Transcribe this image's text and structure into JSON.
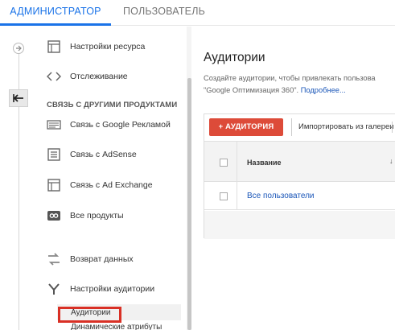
{
  "tabs": {
    "admin": "АДМИНИСТРАТОР",
    "user": "ПОЛЬЗОВАТЕЛЬ"
  },
  "nav": {
    "items": [
      {
        "label": "Настройки ресурса",
        "icon": "property-settings-icon"
      },
      {
        "label": "Отслеживание",
        "icon": "code-icon"
      }
    ],
    "section_title": "СВЯЗЬ С ДРУГИМИ ПРОДУКТАМИ",
    "linked": [
      {
        "label": "Связь с Google Рекламой",
        "icon": "google-ads-icon"
      },
      {
        "label": "Связь с AdSense",
        "icon": "adsense-icon"
      },
      {
        "label": "Связь с Ad Exchange",
        "icon": "ad-exchange-icon"
      },
      {
        "label": "Все продукты",
        "icon": "all-products-icon"
      }
    ],
    "data_return": {
      "label": "Возврат данных",
      "icon": "data-return-icon"
    },
    "audience_settings": {
      "label": "Настройки аудитории",
      "icon": "audience-settings-icon"
    },
    "sub_items": [
      "Аудитории",
      "Динамические атрибуты"
    ]
  },
  "main": {
    "title": "Аудитории",
    "desc_line1": "Создайте аудитории, чтобы привлекать пользова",
    "desc_line2": "\"Google Оптимизация 360\".",
    "desc_link": "Подробнее...",
    "add_button": "+ АУДИТОРИЯ",
    "import_button": "Импортировать из галереи",
    "column_name": "Название",
    "sort_indicator": "↓",
    "rows": [
      "Все пользователи"
    ]
  },
  "colors": {
    "accent": "#1a73e8",
    "add_button": "#dd4b39",
    "highlight_box": "#d93025",
    "link": "#1a56b8"
  }
}
